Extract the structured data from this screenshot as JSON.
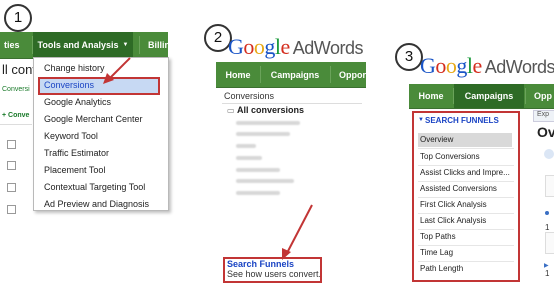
{
  "steps": [
    "1",
    "2",
    "3"
  ],
  "logo": {
    "g1": "G",
    "o1": "o",
    "o2": "o",
    "g2": "g",
    "l": "l",
    "e": "e",
    "product": "AdWords"
  },
  "panel1": {
    "nav_left_fragment": "ties",
    "nav_tools": "Tools and Analysis",
    "nav_billing_fragment": "Billing",
    "page_title_fragment": "ll conv",
    "sub_link_fragment": "Conversi",
    "sub_toolbar_fragment": "+ Conve",
    "menu_items": [
      "Change history",
      "Conversions",
      "Google Analytics",
      "Google Merchant Center",
      "Keyword Tool",
      "Traffic Estimator",
      "Placement Tool",
      "Contextual Targeting Tool",
      "Ad Preview and Diagnosis"
    ]
  },
  "panel2": {
    "nav_home": "Home",
    "nav_campaigns": "Campaigns",
    "nav_opp_fragment": "Oppor",
    "section_title": "Conversions",
    "all_conversions": "All conversions",
    "search_funnels_title": "Search Funnels",
    "search_funnels_desc": "See how users convert."
  },
  "panel3": {
    "nav_home": "Home",
    "nav_campaigns": "Campaigns",
    "nav_opp_fragment": "Opp",
    "exp_fragment": "Exp",
    "page_title_fragment": "Ov",
    "sidebar_title": "SEARCH FUNNELS",
    "items": [
      "Overview",
      "Top Conversions",
      "Assist Clicks and Impre...",
      "Assisted Conversions",
      "First Click Analysis",
      "Last Click Analysis",
      "Top Paths",
      "Time Lag",
      "Path Length"
    ],
    "right_fragments": [
      "1",
      "1"
    ]
  },
  "colors": {
    "nav_green": "#4a8b3a",
    "nav_active": "#2e6b26",
    "highlight_red": "#c23535",
    "link_blue": "#1a44c4"
  }
}
